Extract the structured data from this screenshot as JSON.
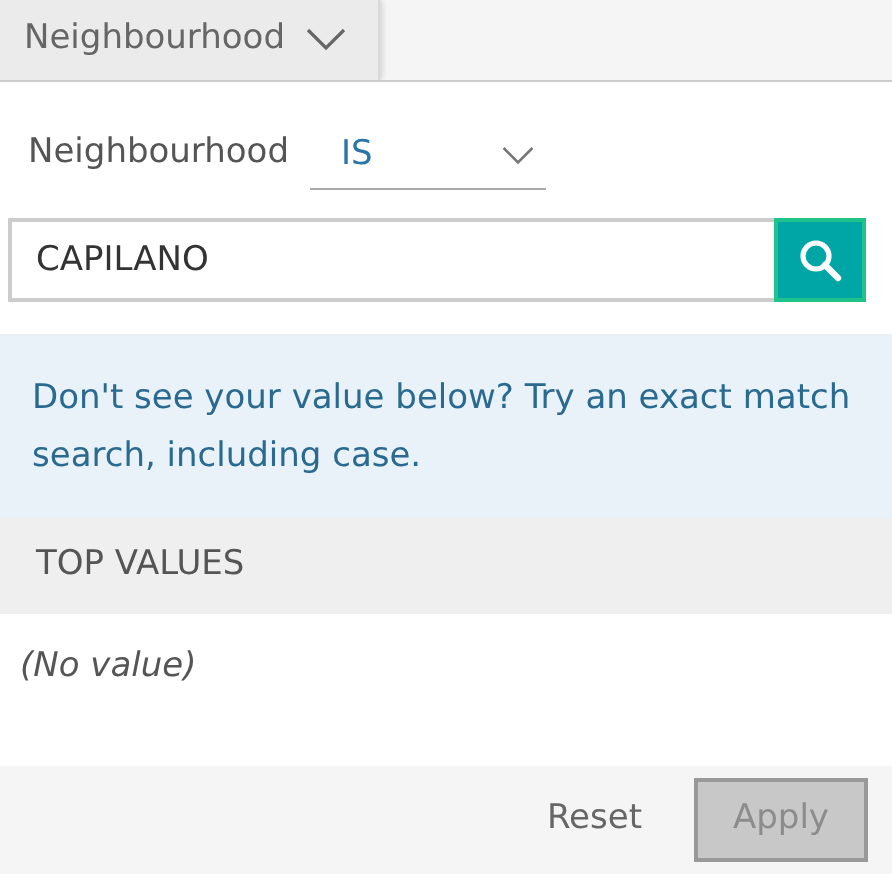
{
  "tab": {
    "label": "Neighbourhood"
  },
  "field_label": "Neighbourhood",
  "operator": {
    "value": "IS"
  },
  "search": {
    "value": "CAPILANO"
  },
  "hint": "Don't see your value below? Try an exact match search, including case.",
  "section_title": "TOP VALUES",
  "values": [
    {
      "label": "(No value)"
    }
  ],
  "buttons": [
    {
      "label": "Reset",
      "kind": "link",
      "disabled": false
    },
    {
      "label": "Apply",
      "kind": "primary",
      "disabled": true
    }
  ]
}
